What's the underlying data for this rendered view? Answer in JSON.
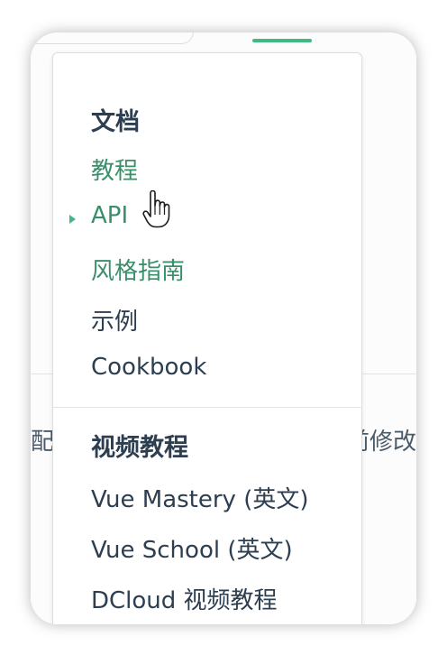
{
  "background": {
    "left_fragment": "配",
    "right_fragment": "前修改"
  },
  "dropdown": {
    "groups": [
      {
        "title": "文档",
        "items": [
          {
            "label": "教程",
            "active": false
          },
          {
            "label": "API",
            "active": true
          },
          {
            "label": "风格指南",
            "active": false
          },
          {
            "label": "示例",
            "active": false
          },
          {
            "label": "Cookbook",
            "active": false
          }
        ]
      },
      {
        "title": "视频教程",
        "items": [
          {
            "label": "Vue Mastery (英文)",
            "active": false
          },
          {
            "label": "Vue School (英文)",
            "active": false
          },
          {
            "label": "DCloud 视频教程",
            "active": false
          }
        ]
      }
    ]
  },
  "colors": {
    "accent": "#42b883",
    "accent_text": "#3a8f6b",
    "text": "#2c3e50"
  },
  "icons": {
    "cursor": "hand-pointer-icon",
    "active_marker": "triangle-right-icon"
  }
}
